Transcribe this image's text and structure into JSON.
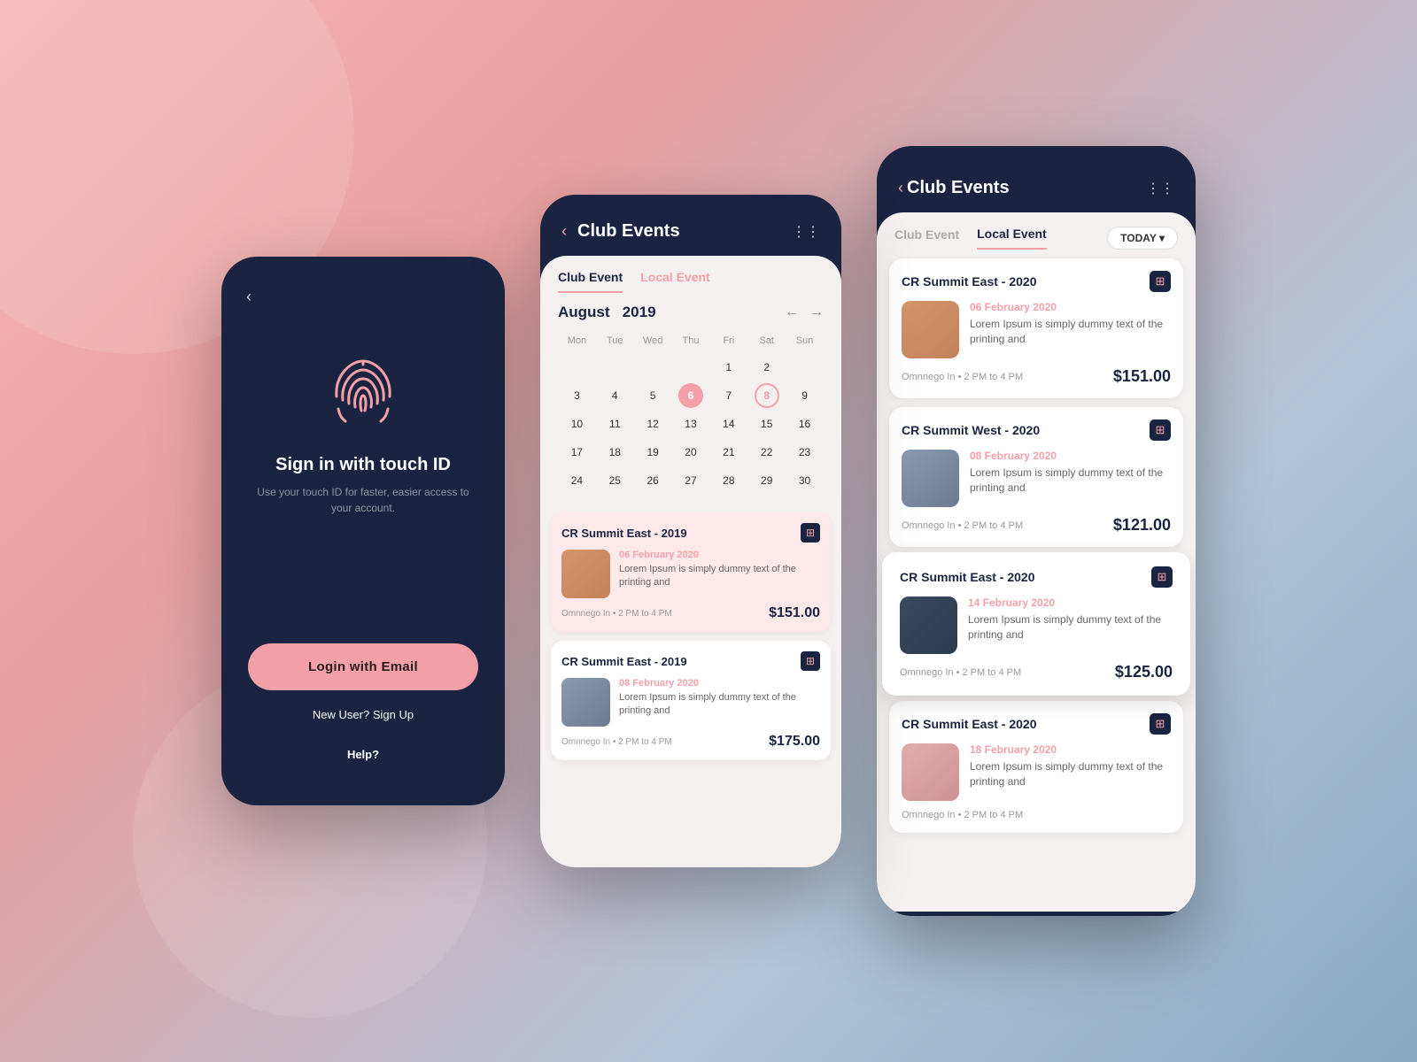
{
  "background": {
    "gradient_start": "#f8b4b4",
    "gradient_end": "#8aa8c0"
  },
  "screen1": {
    "title": "Sign in with touch ID",
    "subtitle": "Use your touch ID for faster, easier access to your account.",
    "login_button": "Login with Email",
    "new_user_text": "New User? Sign Up",
    "help_text": "Help?",
    "back_icon": "‹"
  },
  "screen2": {
    "header_title": "Club Events",
    "back_icon": "‹",
    "dots_icon": "⋮⋮",
    "tabs": [
      {
        "label": "Club Event",
        "active": true
      },
      {
        "label": "Local Event",
        "active": false
      }
    ],
    "calendar": {
      "month": "August",
      "year": "2019",
      "day_names": [
        "Mon",
        "Tue",
        "Wed",
        "Thu",
        "Fri",
        "Sat",
        "Sun"
      ],
      "weeks": [
        [
          "",
          "",
          "",
          "",
          "1",
          "2",
          ""
        ],
        [
          "3",
          "4",
          "5",
          "6",
          "7",
          "8",
          "9"
        ],
        [
          "10",
          "11",
          "12",
          "13",
          "14",
          "15",
          "16"
        ],
        [
          "17",
          "18",
          "19",
          "20",
          "21",
          "22",
          "23"
        ],
        [
          "24",
          "25",
          "26",
          "27",
          "28",
          "29",
          "30"
        ]
      ],
      "highlighted_dates": [
        "6",
        "8"
      ]
    },
    "events": [
      {
        "title": "CR Summit East - 2019",
        "date": "06 February 2020",
        "description": "Lorem Ipsum is simply dummy text of the printing and",
        "meta": "Omnnego In  •  2 PM to 4 PM",
        "price": "$151.00",
        "img_class": "img-crowd",
        "highlighted": true
      },
      {
        "title": "CR Summit East - 2019",
        "date": "08 February 2020",
        "description": "Lorem Ipsum is simply dummy text of the printing and",
        "meta": "Omnnego In  •  2 PM to 4 PM",
        "price": "$175.00",
        "img_class": "img-people",
        "highlighted": false
      }
    ]
  },
  "screen3": {
    "header_title": "Club Events",
    "back_icon": "‹",
    "dots_icon": "⋮⋮",
    "tabs": [
      {
        "label": "Club Event",
        "active": false
      },
      {
        "label": "Local Event",
        "active": true
      }
    ],
    "today_button": "TODAY",
    "events": [
      {
        "title": "CR Summit East - 2020",
        "date": "06 February 2020",
        "description": "Lorem Ipsum is simply dummy text of the printing and",
        "meta": "Omnnego In  •  2 PM to 4 PM",
        "price": "$151.00",
        "img_class": "img-crowd",
        "elevated": false
      },
      {
        "title": "CR Summit West - 2020",
        "date": "08 February 2020",
        "description": "Lorem Ipsum is simply dummy text of the printing and",
        "meta": "Omnnego In  •  2 PM to 4 PM",
        "price": "$121.00",
        "img_class": "img-people",
        "elevated": false
      },
      {
        "title": "CR Summit East - 2020",
        "date": "14 February 2020",
        "description": "Lorem Ipsum is simply dummy text of the printing and",
        "meta": "Omnnego In  •  2 PM to 4 PM",
        "price": "$125.00",
        "img_class": "img-dark",
        "elevated": true
      },
      {
        "title": "CR Summit East - 2020",
        "date": "18 February 2020",
        "description": "Lorem Ipsum is simply dummy text of the printing and",
        "meta": "Omnnego In  •  2 PM to 4 PM",
        "price": "",
        "img_class": "img-flower",
        "elevated": false
      }
    ]
  }
}
